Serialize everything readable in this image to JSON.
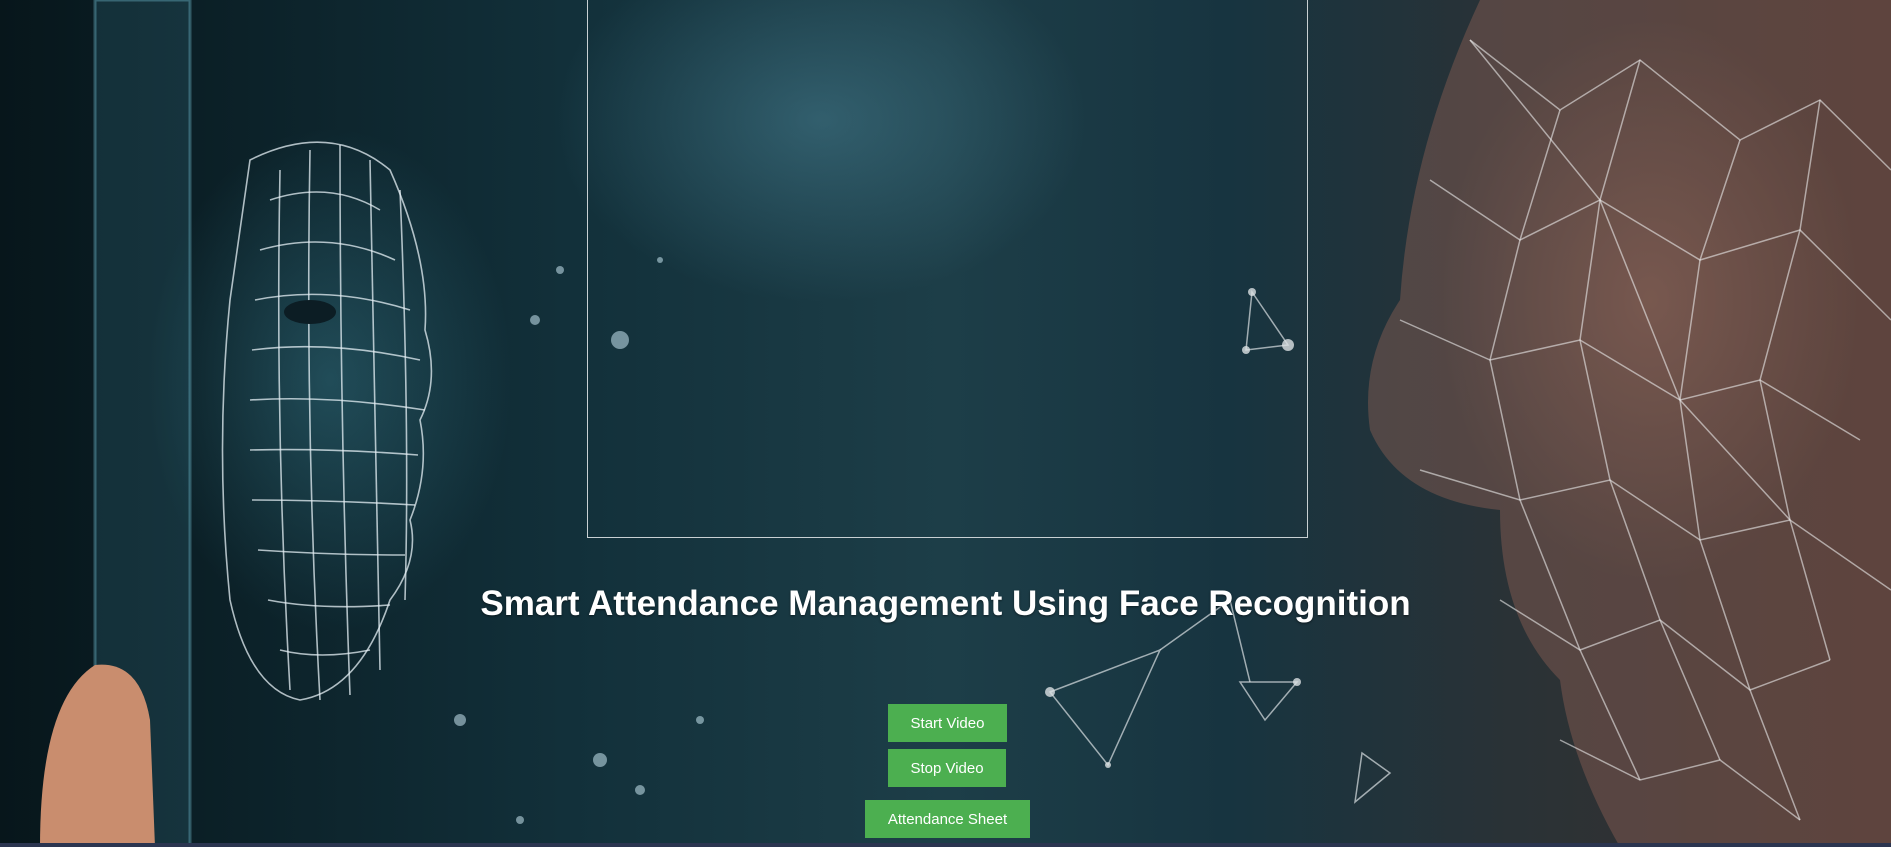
{
  "page": {
    "title": "Smart Attendance Management Using Face Recognition"
  },
  "buttons": {
    "start_video": "Start Video",
    "stop_video": "Stop Video",
    "attendance_sheet": "Attendance Sheet"
  },
  "colors": {
    "button_bg": "#4caf50",
    "button_text": "#ffffff",
    "title_text": "#ffffff",
    "video_border": "#c8d0d3"
  },
  "background": {
    "icon": "face-recognition-mesh-image"
  }
}
